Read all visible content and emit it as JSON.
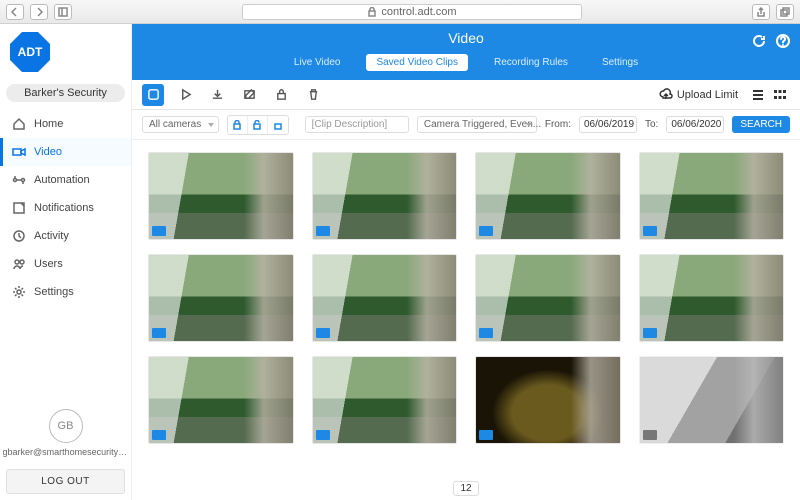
{
  "browser": {
    "url_display": "control.adt.com"
  },
  "brand": {
    "logo_text": "ADT"
  },
  "account": {
    "name": "Barker's Security"
  },
  "nav": {
    "items": [
      {
        "label": "Home",
        "icon": "home-icon"
      },
      {
        "label": "Video",
        "icon": "video-icon"
      },
      {
        "label": "Automation",
        "icon": "automation-icon"
      },
      {
        "label": "Notifications",
        "icon": "notifications-icon"
      },
      {
        "label": "Activity",
        "icon": "activity-icon"
      },
      {
        "label": "Users",
        "icon": "users-icon"
      },
      {
        "label": "Settings",
        "icon": "settings-icon"
      }
    ],
    "active_index": 1
  },
  "user": {
    "initials": "GB",
    "email": "gbarker@smarthomesecuritycontrol",
    "logout_label": "LOG OUT"
  },
  "header": {
    "title": "Video",
    "tabs": [
      {
        "label": "Live Video"
      },
      {
        "label": "Saved Video Clips"
      },
      {
        "label": "Recording Rules"
      },
      {
        "label": "Settings"
      }
    ],
    "active_tab": 1
  },
  "toolbar": {
    "upload_label": "Upload Limit"
  },
  "filters": {
    "camera_selected": "All cameras",
    "description_placeholder": "[Clip Description]",
    "trigger_selected": "Camera Triggered, Even...",
    "from_label": "From:",
    "from_value": "06/06/2019",
    "to_label": "To:",
    "to_value": "06/06/2020",
    "search_label": "SEARCH"
  },
  "clips": [
    {
      "kind": "day"
    },
    {
      "kind": "day"
    },
    {
      "kind": "day"
    },
    {
      "kind": "day"
    },
    {
      "kind": "day"
    },
    {
      "kind": "day"
    },
    {
      "kind": "day"
    },
    {
      "kind": "day"
    },
    {
      "kind": "day"
    },
    {
      "kind": "day"
    },
    {
      "kind": "night"
    },
    {
      "kind": "ir"
    }
  ],
  "pagination": {
    "current": "12"
  }
}
